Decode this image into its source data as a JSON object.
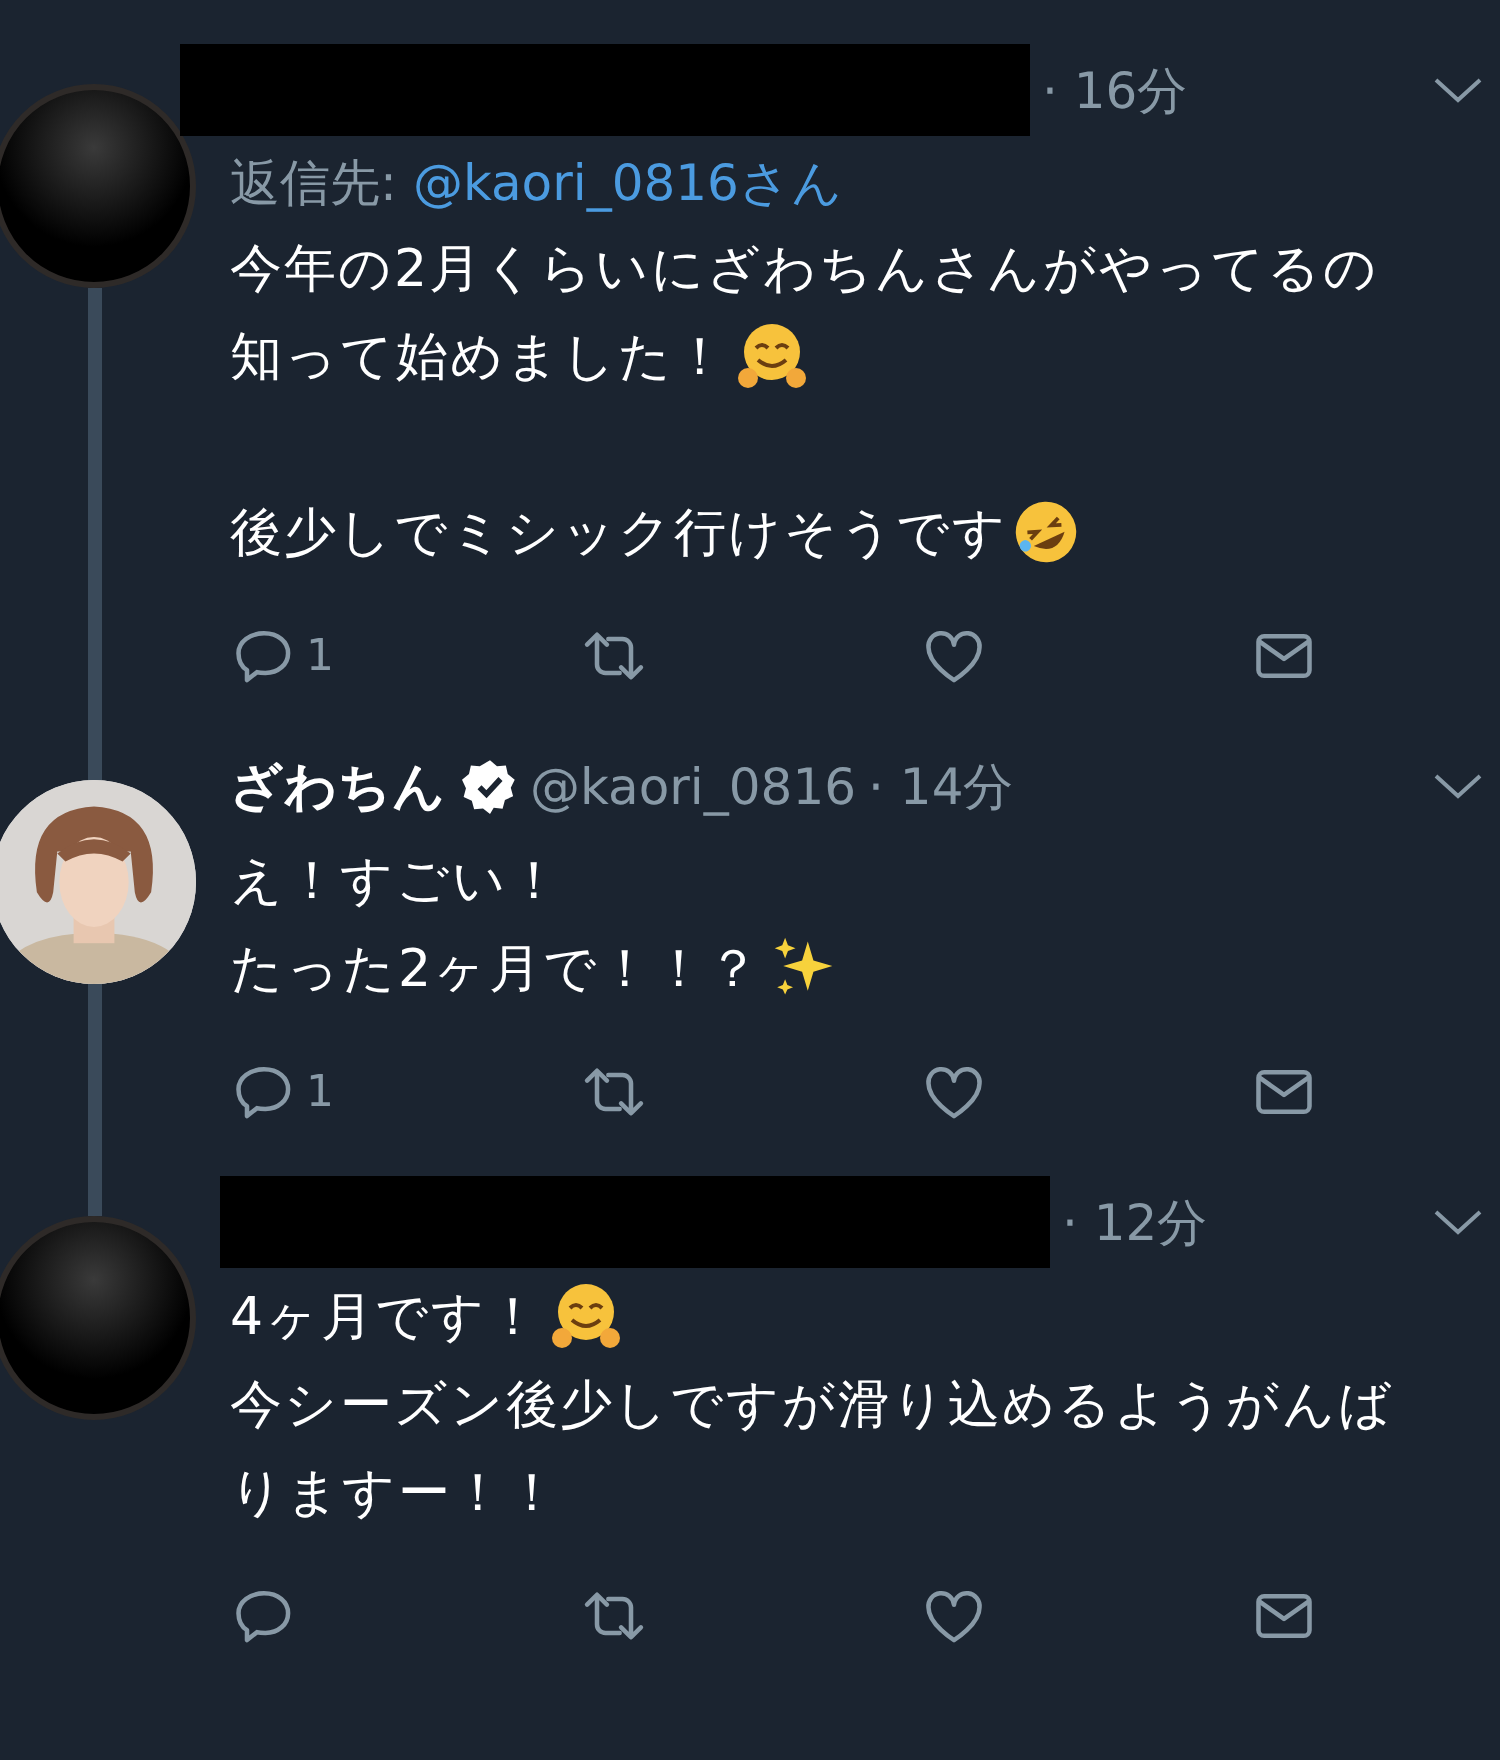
{
  "tweets": [
    {
      "author": {
        "kind": "redacted"
      },
      "avatar": {
        "kind": "redacted"
      },
      "time": "· 16分",
      "reply_to": {
        "label": "返信先:",
        "handle": "@kaori_0816さん"
      },
      "connected_above": false,
      "connected_below": true,
      "paragraphs": [
        [
          {
            "text": "今年の2月くらいにざわちんさんがやってるの",
            "kind": "plain"
          },
          {
            "text": "知って始めました！",
            "kind": "hug"
          }
        ],
        [
          {
            "text": "後少しでミシック行けそうです",
            "kind": "laugh"
          }
        ]
      ],
      "actions": {
        "replies": "1"
      }
    },
    {
      "author": {
        "kind": "named",
        "name": "ざわちん",
        "verified": true,
        "handle": "@kaori_0816"
      },
      "avatar": {
        "kind": "picture"
      },
      "time": "· 14分",
      "connected_above": true,
      "connected_below": true,
      "paragraphs": [
        [
          {
            "text": "え！すごい！",
            "kind": "plain"
          },
          {
            "text": "たった2ヶ月で！！？",
            "kind": "sparkles"
          }
        ]
      ],
      "actions": {
        "replies": "1"
      }
    },
    {
      "author": {
        "kind": "redacted"
      },
      "avatar": {
        "kind": "redacted"
      },
      "time": "· 12分",
      "connected_above": true,
      "connected_below": false,
      "paragraphs": [
        [
          {
            "text": "4ヶ月です！",
            "kind": "hug"
          },
          {
            "text": "今シーズン後少しですが滑り込めるようがんば",
            "kind": "plain"
          },
          {
            "text": "りますー！！",
            "kind": "plain"
          }
        ]
      ]
    }
  ]
}
